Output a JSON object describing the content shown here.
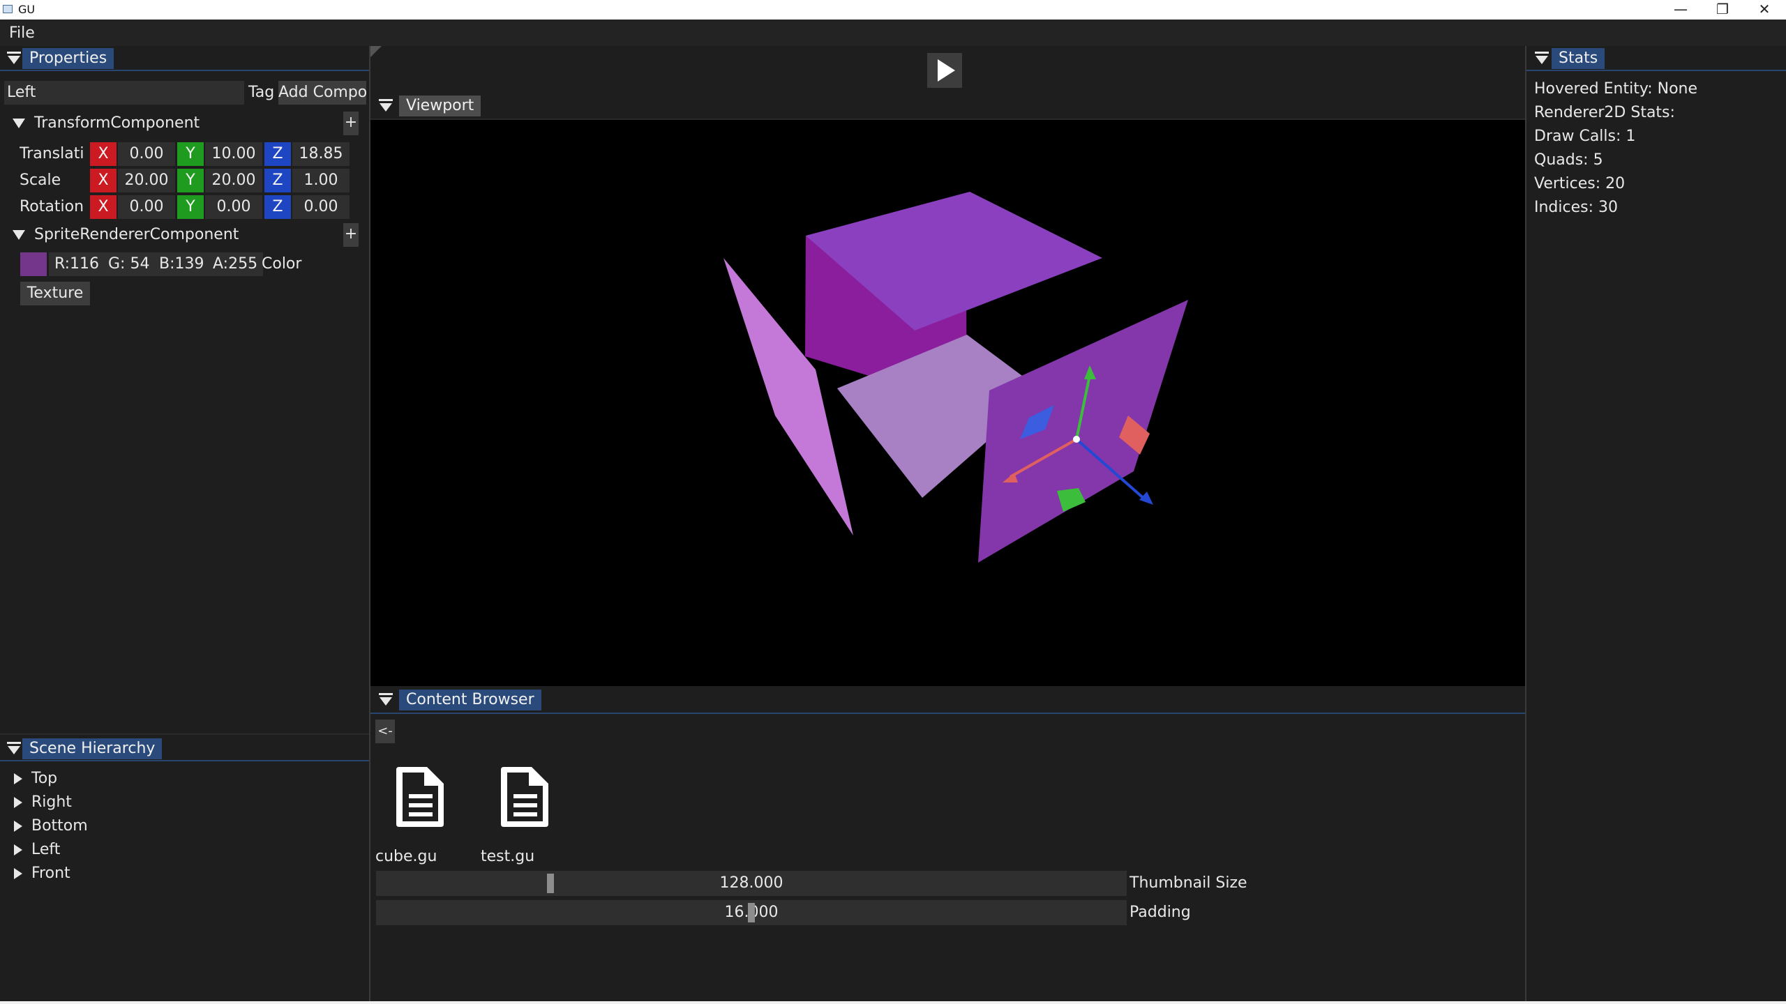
{
  "window": {
    "title": "GU",
    "min_glyph": "—",
    "restore_glyph": "❐",
    "close_glyph": "✕"
  },
  "menu": {
    "items": [
      "File"
    ]
  },
  "properties": {
    "tab": "Properties",
    "entity_name": "Left",
    "tag_label": "Tag",
    "add_component": "Add Compo",
    "transform": {
      "header": "TransformComponent",
      "plus": "+",
      "rows": [
        {
          "label": "Translati",
          "x": "0.00",
          "y": "10.00",
          "z": "18.85"
        },
        {
          "label": "Scale",
          "x": "20.00",
          "y": "20.00",
          "z": "1.00"
        },
        {
          "label": "Rotation",
          "x": "0.00",
          "y": "0.00",
          "z": "0.00"
        }
      ],
      "axis_labels": {
        "x": "X",
        "y": "Y",
        "z": "Z"
      }
    },
    "sprite": {
      "header": "SpriteRendererComponent",
      "plus": "+",
      "swatch_color": "#74368b",
      "r": "R:116",
      "g": "G: 54",
      "b": "B:139",
      "a": "A:255",
      "color_label": "Color",
      "texture_button": "Texture"
    }
  },
  "scene_hierarchy": {
    "tab": "Scene Hierarchy",
    "items": [
      "Top",
      "Right",
      "Bottom",
      "Left",
      "Front"
    ]
  },
  "toolbar": {
    "play_icon": "play-icon"
  },
  "viewport": {
    "tab": "Viewport"
  },
  "content_browser": {
    "tab": "Content Browser",
    "back": "<-",
    "files": [
      "cube.gu",
      "test.gu"
    ],
    "thumbnail_size": {
      "value": "128.000",
      "label": "Thumbnail Size",
      "fraction": 0.23
    },
    "padding": {
      "value": "16.000",
      "label": "Padding",
      "fraction": 0.5
    }
  },
  "stats": {
    "tab": "Stats",
    "lines": [
      "Hovered Entity: None",
      "Renderer2D Stats:",
      "Draw Calls: 1",
      "Quads: 5",
      "Vertices: 20",
      "Indices: 30"
    ]
  }
}
